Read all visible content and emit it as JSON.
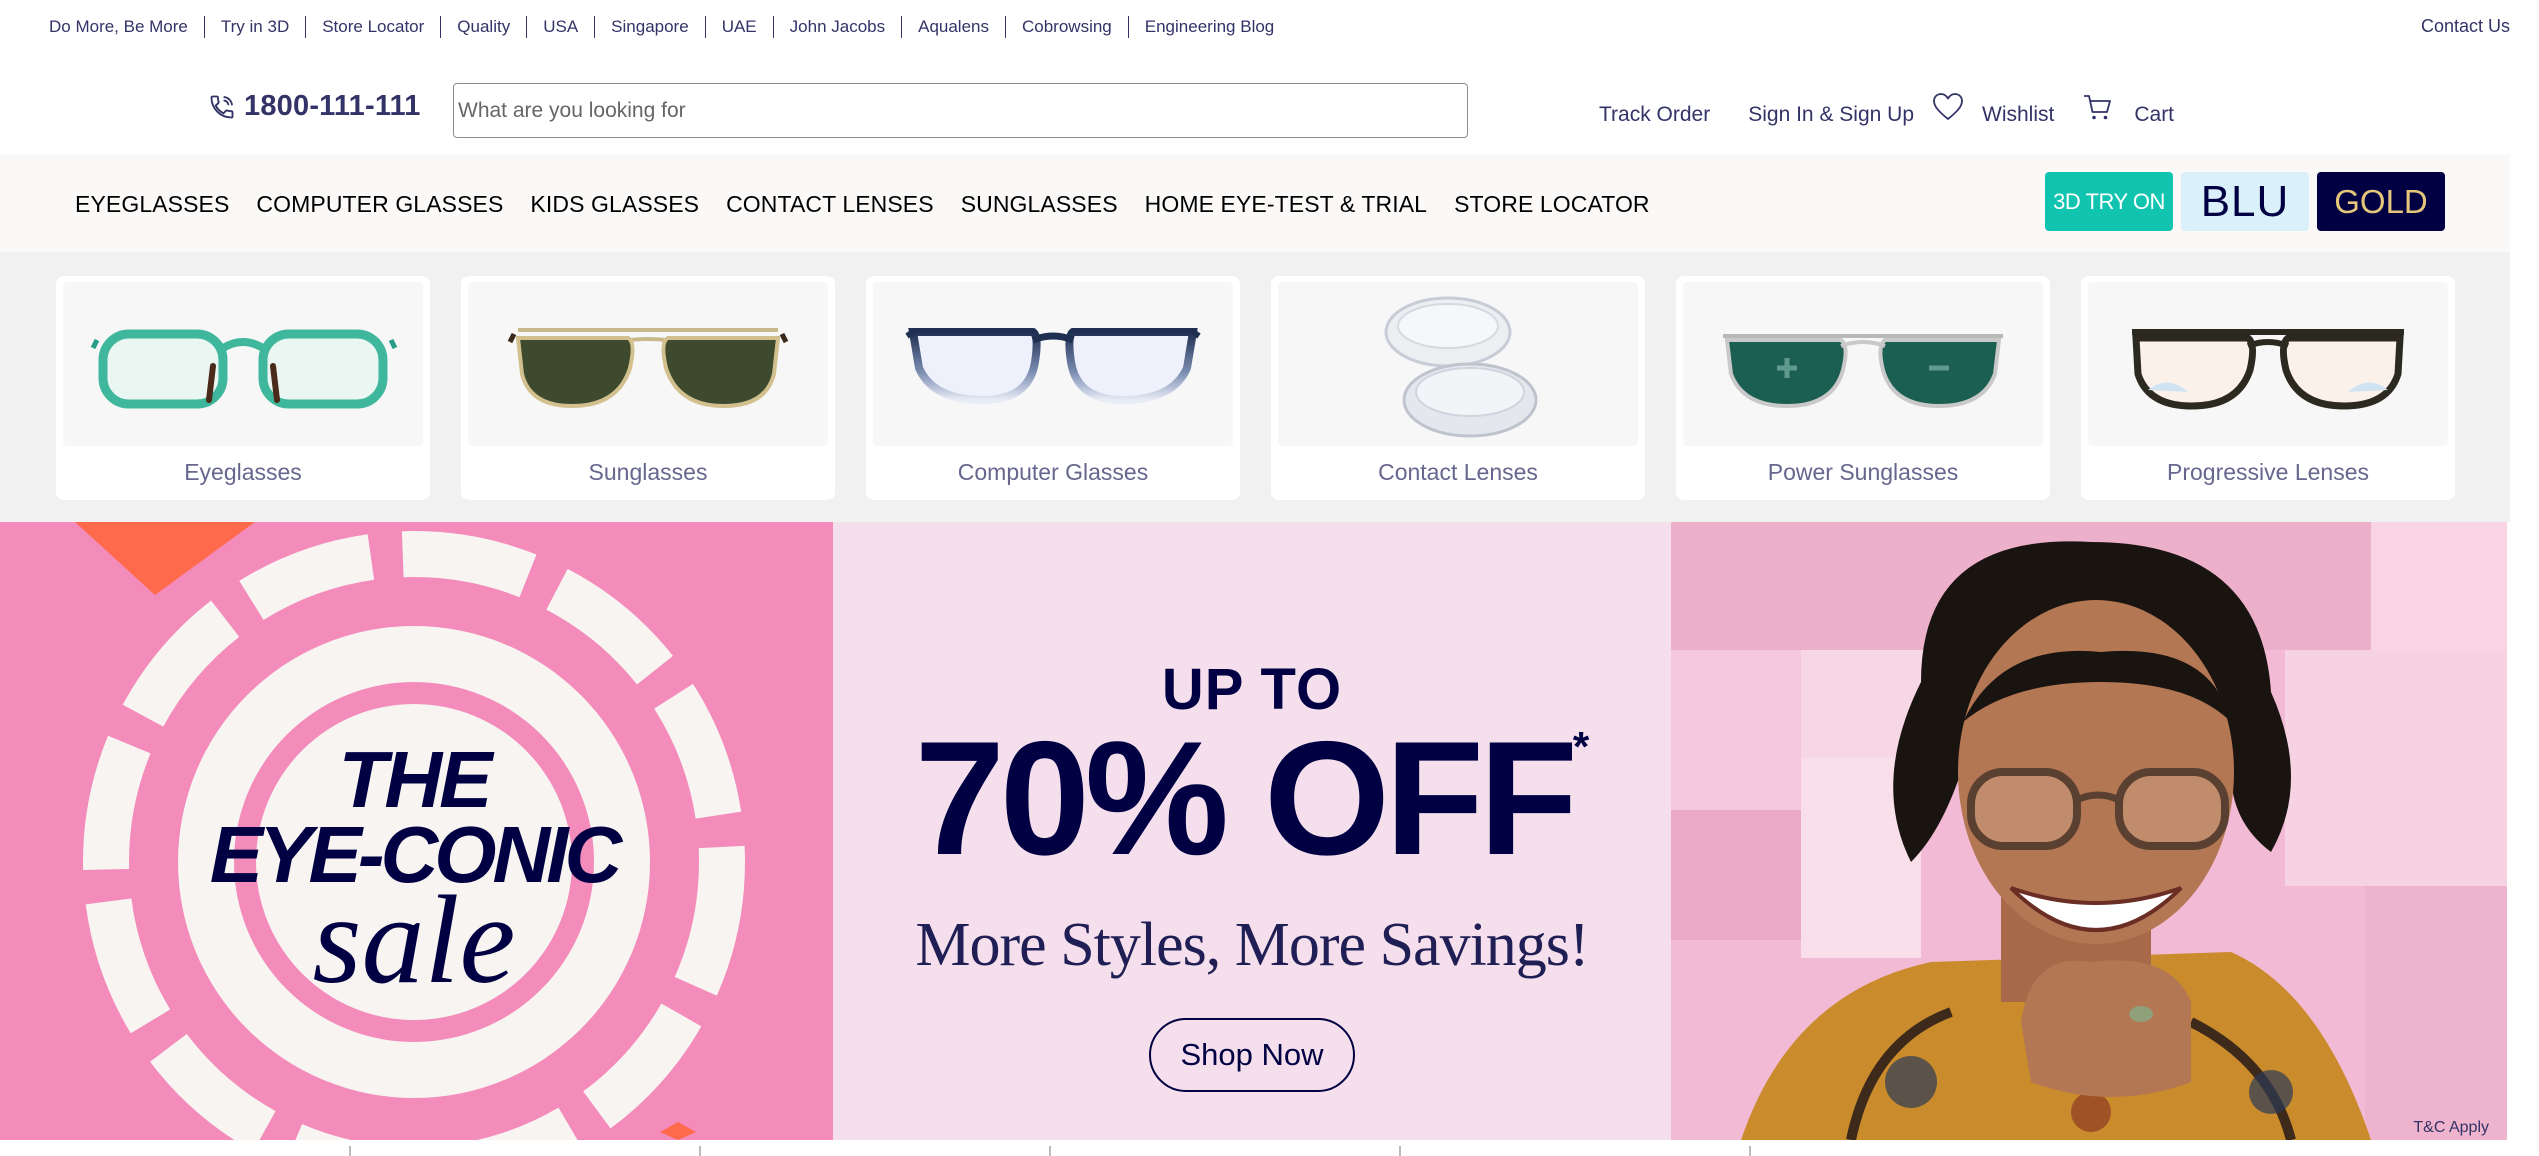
{
  "top_links": [
    "Do More, Be More",
    "Try in 3D",
    "Store Locator",
    "Quality",
    "USA",
    "Singapore",
    "UAE",
    "John Jacobs",
    "Aqualens",
    "Cobrowsing",
    "Engineering Blog"
  ],
  "contact_us": "Contact Us",
  "header": {
    "phone": "1800-111-111",
    "search_placeholder": "What are you looking for",
    "track_order": "Track Order",
    "sign_in": "Sign In & Sign Up",
    "wishlist": "Wishlist",
    "cart": "Cart"
  },
  "nav": {
    "items": [
      "EYEGLASSES",
      "COMPUTER GLASSES",
      "KIDS GLASSES",
      "CONTACT LENSES",
      "SUNGLASSES",
      "HOME EYE-TEST & TRIAL",
      "STORE LOCATOR"
    ],
    "btn_3d": "3D TRY ON",
    "btn_blu": "BLU",
    "btn_gold": "GOLD"
  },
  "categories": [
    {
      "label": "Eyeglasses",
      "icon": "eyeglasses-icon"
    },
    {
      "label": "Sunglasses",
      "icon": "sunglasses-icon"
    },
    {
      "label": "Computer Glasses",
      "icon": "computer-glasses-icon"
    },
    {
      "label": "Contact Lenses",
      "icon": "contact-lenses-icon"
    },
    {
      "label": "Power Sunglasses",
      "icon": "power-sunglasses-icon"
    },
    {
      "label": "Progressive Lenses",
      "icon": "progressive-lenses-icon"
    }
  ],
  "hero": {
    "badge_the": "THE",
    "badge_eyeconic": "EYE-CONIC",
    "badge_sale": "sale",
    "up_to": "UP TO",
    "discount": "70% OFF",
    "asterisk": "*",
    "subtitle": "More Styles, More Savings!",
    "shop_now": "Shop Now",
    "tc": "T&C Apply"
  },
  "colors": {
    "navy": "#000042",
    "teal": "#11c4b0",
    "pink": "#f38cbb",
    "light_pink": "#f5dfec"
  }
}
